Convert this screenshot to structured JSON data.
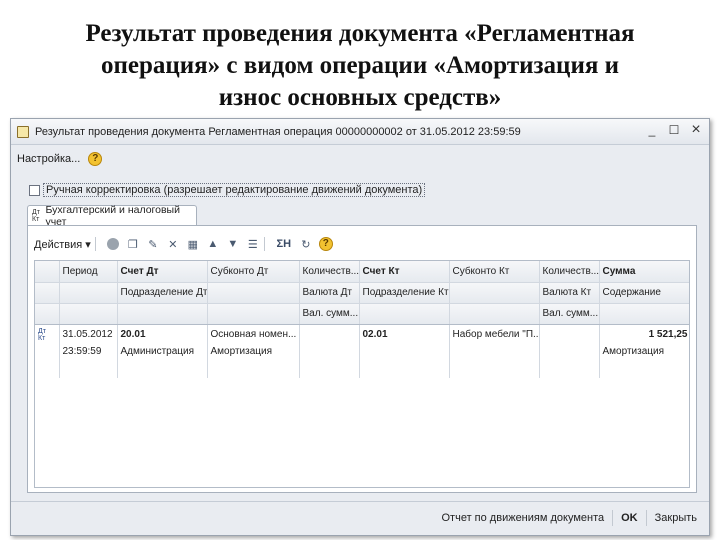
{
  "slide": {
    "title_lines": [
      "Результат проведения документа «Регламентная",
      "операция» с видом операции «Амортизация и",
      "износ основных средств»"
    ]
  },
  "window": {
    "title": "Результат проведения документа Регламентная операция 00000000002 от 31.05.2012 23:59:59",
    "controls": [
      "minimize-icon",
      "maximize-icon",
      "close-icon"
    ]
  },
  "menu": {
    "settings_label": "Настройка...",
    "help_glyph": "?"
  },
  "manual_edit": {
    "checked": false,
    "label": "Ручная корректировка (разрешает редактирование движений документа)"
  },
  "tab": {
    "icon_text_top": "Дт",
    "icon_text_bottom": "Кт",
    "label": "Бухгалтерский и налоговый учет"
  },
  "toolbar": {
    "actions_label": "Действия",
    "actions_arrow": "▾",
    "sum_glyph": "ΣH",
    "help_glyph": "?"
  },
  "table": {
    "header_row1": [
      "",
      "Период",
      "Счет Дт",
      "Субконто Дт",
      "Количеств...",
      "Счет Кт",
      "Субконто Кт",
      "Количеств...",
      "Сумма"
    ],
    "header_row2": [
      "",
      "",
      "Подразделение Дт",
      "",
      "Валюта Дт",
      "Подразделение Кт",
      "",
      "Валюта Кт",
      "Содержание"
    ],
    "header_row3": [
      "",
      "",
      "",
      "",
      "Вал. сумм...",
      "",
      "",
      "Вал. сумм...",
      ""
    ],
    "rows": [
      {
        "icon_top": "Дт",
        "icon_bottom": "Кт",
        "date": "31.05.2012",
        "time": "23:59:59",
        "acc_dt": "20.01",
        "dept_dt": "Администрация",
        "subconto_dt_1": "Основная номен...",
        "subconto_dt_2": "Амортизация",
        "acc_kt": "02.01",
        "subconto_kt": "Набор мебели \"П...",
        "amount": "1 521,25",
        "content": "Амортизация"
      }
    ]
  },
  "footer": {
    "report_button": "Отчет по движениям документа",
    "ok_button": "OK",
    "close_button": "Закрыть"
  }
}
